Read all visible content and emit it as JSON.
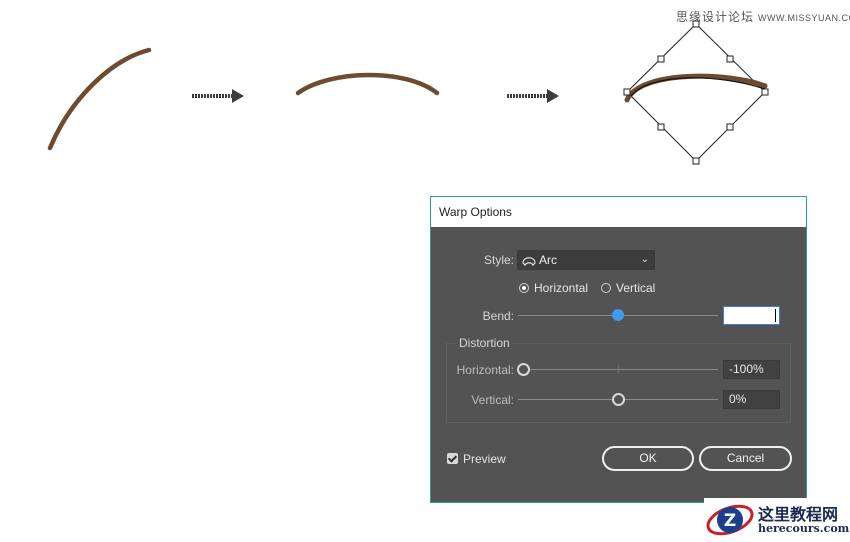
{
  "watermark": {
    "chinese": "思缘设计论坛",
    "url": "WWW.MISSYUAN.COM"
  },
  "colors": {
    "stroke_brown": "#6e4b2e",
    "dialog_bg": "#535353",
    "accent_blue": "#3e9bef",
    "dialog_border": "#2b9f8f"
  },
  "dialog": {
    "title": "Warp Options",
    "style_label": "Style:",
    "style_value": "Arc",
    "style_icon": "arc-warp-icon",
    "orientation": {
      "horizontal_label": "Horizontal",
      "vertical_label": "Vertical",
      "selected": "Horizontal"
    },
    "bend_label": "Bend:",
    "bend_value": "",
    "bend_slider_fraction": 0.5,
    "distortion": {
      "title": "Distortion",
      "horizontal_label": "Horizontal:",
      "horizontal_value": "-100%",
      "horizontal_slider_fraction": 0.0,
      "vertical_label": "Vertical:",
      "vertical_value": "0%",
      "vertical_slider_fraction": 0.5
    },
    "preview_label": "Preview",
    "preview_checked": true,
    "ok_label": "OK",
    "cancel_label": "Cancel"
  },
  "brand": {
    "name": "这里教程网",
    "url": "herecours.com",
    "logo_letter": "Z"
  }
}
